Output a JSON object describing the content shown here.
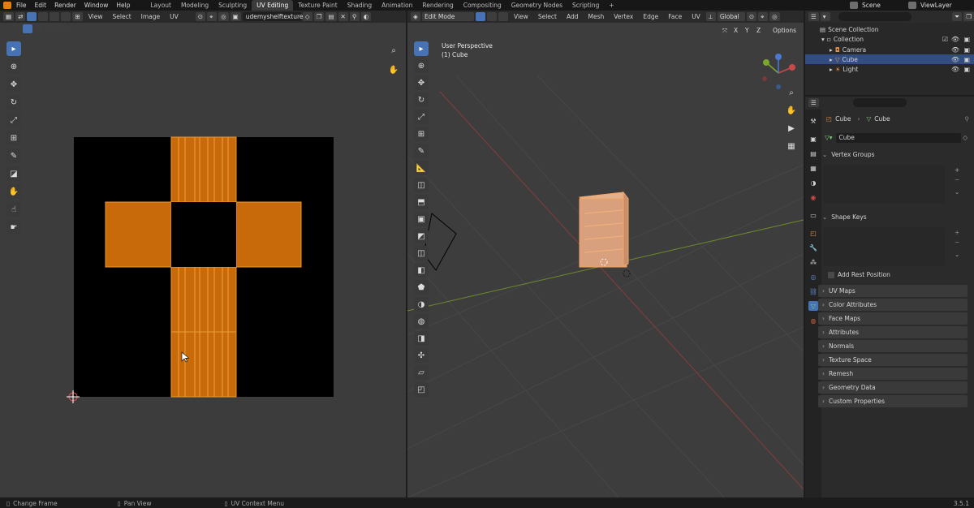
{
  "menu": [
    "File",
    "Edit",
    "Render",
    "Window",
    "Help"
  ],
  "workspaces": [
    "Layout",
    "Modeling",
    "Sculpting",
    "UV Editing",
    "Texture Paint",
    "Shading",
    "Animation",
    "Rendering",
    "Compositing",
    "Geometry Nodes",
    "Scripting",
    "+"
  ],
  "active_workspace": "UV Editing",
  "scene": {
    "label": "Scene",
    "view_layer": "ViewLayer"
  },
  "uv_editor": {
    "menus": [
      "View",
      "Select",
      "Image",
      "UV"
    ],
    "image_name": "udemyshelftexture",
    "grid_colors": {
      "island": "#c96a0a",
      "edge": "#e89a33",
      "bg": "#000000"
    }
  },
  "viewport": {
    "mode": "Edit Mode",
    "menus": [
      "View",
      "Select",
      "Add",
      "Mesh",
      "Vertex",
      "Edge",
      "Face",
      "UV"
    ],
    "orientation": "Global",
    "overlay_text_1": "User Perspective",
    "overlay_text_2": "(1) Cube",
    "options_label": "Options",
    "axes": [
      "X",
      "Y",
      "Z"
    ]
  },
  "outliner": {
    "scene_collection": "Scene Collection",
    "collection": "Collection",
    "items": [
      "Camera",
      "Cube",
      "Light"
    ],
    "selected": "Cube"
  },
  "properties": {
    "breadcrumb_object": "Cube",
    "breadcrumb_mesh": "Cube",
    "mesh_name": "Cube",
    "vertex_groups": "Vertex Groups",
    "shape_keys": "Shape Keys",
    "add_rest_position": "Add Rest Position",
    "sections": [
      "UV Maps",
      "Color Attributes",
      "Face Maps",
      "Attributes",
      "Normals",
      "Texture Space",
      "Remesh",
      "Geometry Data",
      "Custom Properties"
    ]
  },
  "status_bar": {
    "left": "Change Frame",
    "middle": "Pan View",
    "right": "UV Context Menu",
    "version": "3.5.1"
  }
}
